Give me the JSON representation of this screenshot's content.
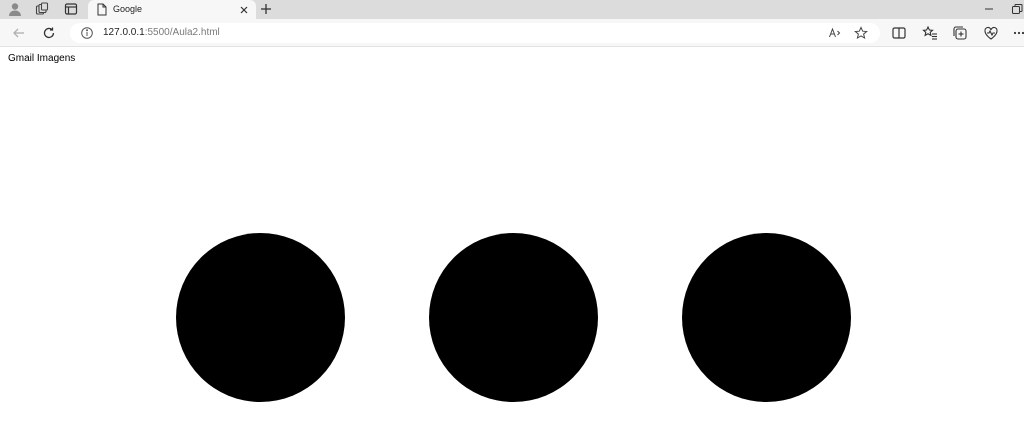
{
  "browser": {
    "tab": {
      "title": "Google"
    },
    "address": {
      "host": "127.0.0.1",
      "rest": ":5500/Aula2.html"
    }
  },
  "page": {
    "links": [
      {
        "label": "Gmail"
      },
      {
        "label": "Imagens"
      }
    ],
    "circle_color": "#000000"
  },
  "icons": {
    "tabstrip": [
      "profile-icon",
      "workspaces-icon",
      "tab-actions-icon",
      "page-icon",
      "close-icon",
      "new-tab-icon",
      "minimize-icon",
      "restore-icon"
    ],
    "toolbar": [
      "back-icon",
      "refresh-icon",
      "info-icon",
      "read-aloud-icon",
      "favorite-star-icon",
      "split-screen-icon",
      "favorites-icon",
      "collections-icon",
      "browser-essentials-icon",
      "more-icon"
    ]
  }
}
